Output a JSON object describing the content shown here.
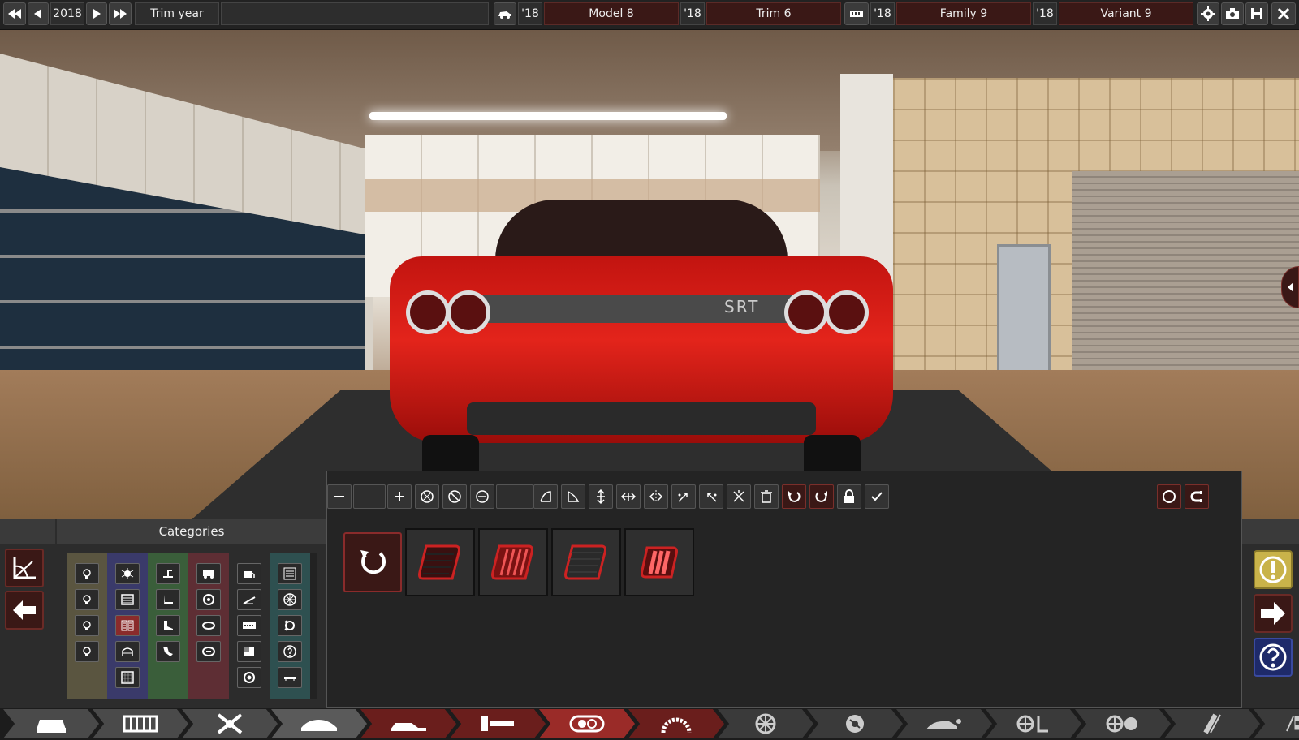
{
  "topbar": {
    "year": "2018",
    "trim_year_label": "Trim year",
    "model": {
      "year_short": "'18",
      "name": "Model 8"
    },
    "trim": {
      "year_short": "'18",
      "name": "Trim 6"
    },
    "family": {
      "year_short": "'18",
      "name": "Family 9"
    },
    "variant": {
      "year_short": "'18",
      "name": "Variant 9"
    }
  },
  "categories_panel": {
    "title": "Categories",
    "column_colors": [
      "#5a5540",
      "#3a3a6a",
      "#3a5e3a",
      "#5e2e34",
      "#2c2c2c",
      "#2e5050"
    ]
  },
  "car": {
    "badge": "SRT",
    "paint_color": "#d81e17"
  },
  "colors": {
    "accent_dark_red": "#3a1816",
    "accent_red": "#8a2b2b",
    "warning_yellow": "#c9b34a",
    "help_blue": "#1e2a6a"
  }
}
